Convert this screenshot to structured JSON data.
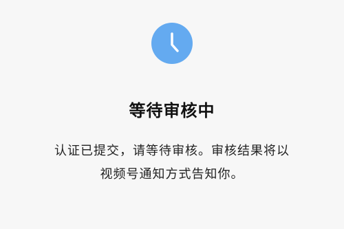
{
  "status": {
    "icon": "clock-icon",
    "icon_color": "#64aaf0",
    "title": "等待审核中",
    "message_line1": "认证已提交，请等待审核。审核结果将以",
    "message_line2": "视频号通知方式告知你。"
  }
}
